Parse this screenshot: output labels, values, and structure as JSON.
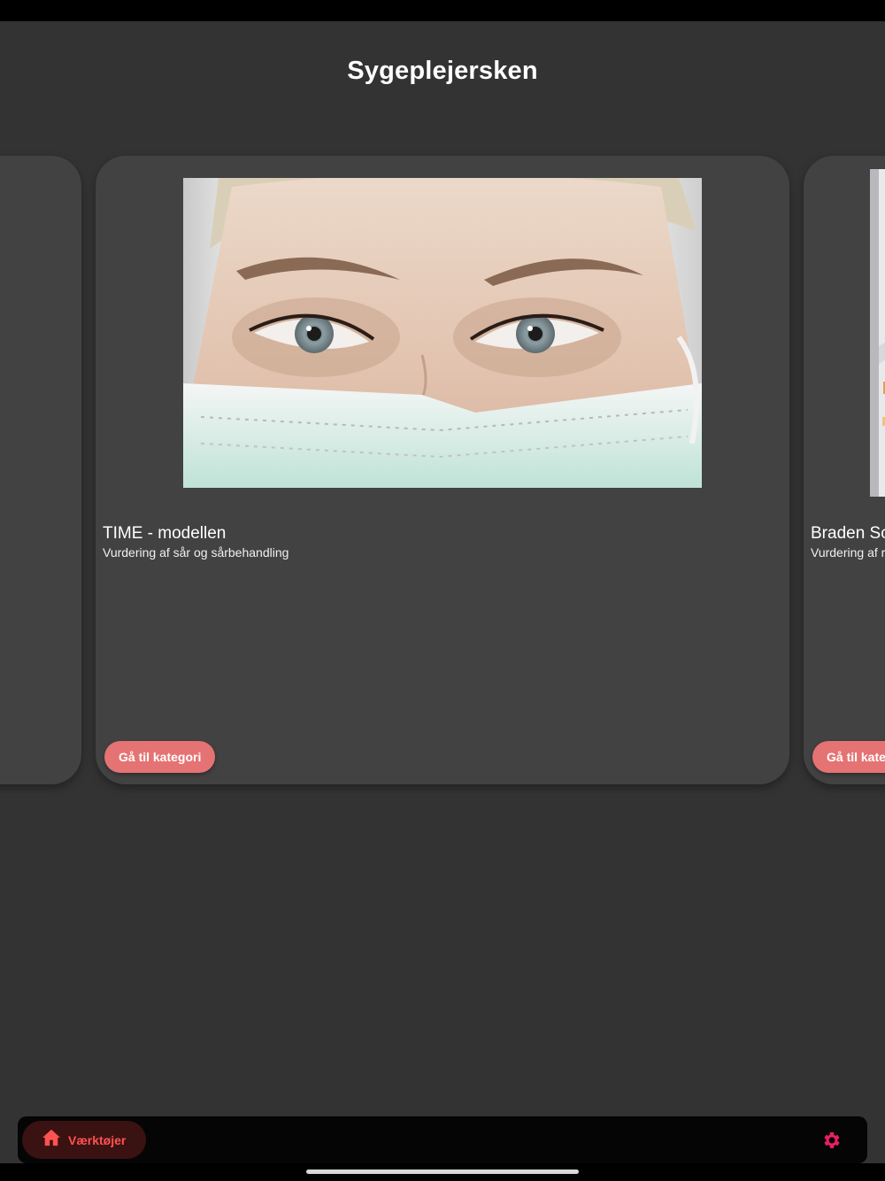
{
  "app": {
    "title": "Sygeplejersken"
  },
  "cards": [
    {
      "title": "TIME - modellen",
      "subtitle": "Vurdering af sår og sårbehandling",
      "button_label": "Gå til kategori"
    },
    {
      "title": "Braden Sc",
      "subtitle": "Vurdering af r",
      "button_label": "Gå til kateg"
    }
  ],
  "bottom_nav": {
    "home_label": "Værktøjer",
    "home_icon": "home-icon",
    "settings_icon": "gear-icon"
  },
  "colors": {
    "background": "#333333",
    "card": "#424242",
    "accent_button": "#e57373",
    "nav_active_bg": "#3a1212",
    "nav_active_text": "#ff5252",
    "settings_icon": "#e91e63"
  }
}
